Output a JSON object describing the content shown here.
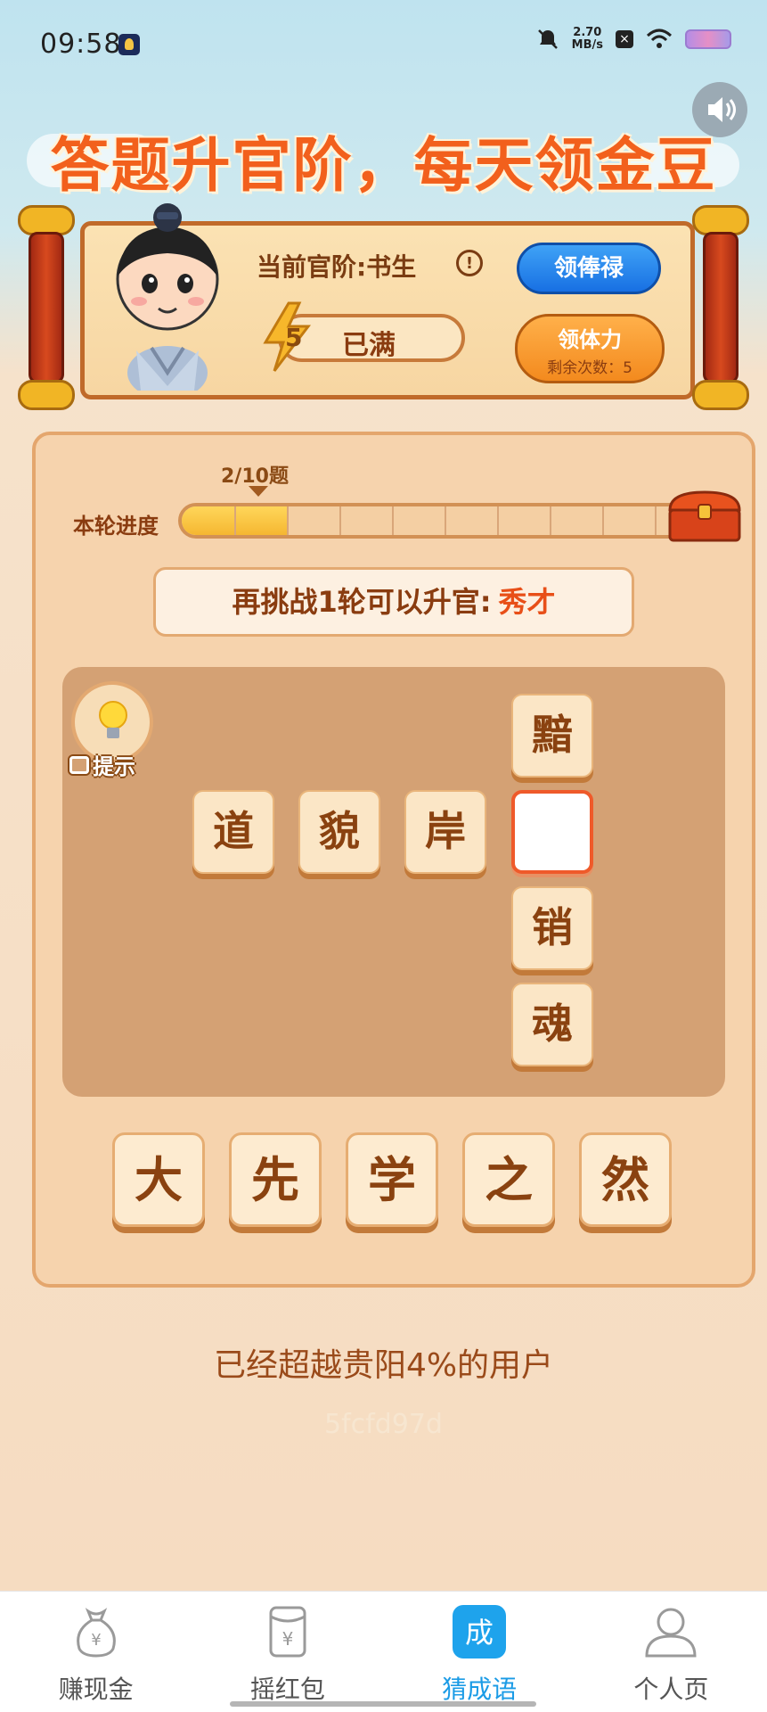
{
  "status_bar": {
    "time": "09:58",
    "network_speed_value": "2.70",
    "network_speed_unit": "MB/s"
  },
  "header": {
    "headline": "答题升官阶，每天领金豆"
  },
  "rank_card": {
    "rank_label": "当前官阶:书生",
    "energy_count": "5",
    "energy_status": "已满",
    "salary_button": "领俸禄",
    "stamina_button": "领体力",
    "stamina_remaining": "剩余次数：5"
  },
  "progress": {
    "marker": "2/10题",
    "label": "本轮进度",
    "current": 2,
    "total": 10
  },
  "challenge": {
    "text": "再挑战1轮可以升官:",
    "next_rank": "秀才"
  },
  "board": {
    "hint_label": "提示",
    "row_tiles": [
      "道",
      "貌",
      "岸"
    ],
    "column_tiles": [
      "黯",
      "",
      "销",
      "魂"
    ]
  },
  "choices": [
    "大",
    "先",
    "学",
    "之",
    "然"
  ],
  "footer": {
    "surpass_text": "已经超越贵阳4%的用户",
    "user_code": "5fcfd97d"
  },
  "nav": {
    "items": [
      {
        "label": "赚现金",
        "icon": "money-bag-icon"
      },
      {
        "label": "摇红包",
        "icon": "red-packet-icon"
      },
      {
        "label": "猜成语",
        "icon": "idiom-icon",
        "icon_text": "成",
        "active": true
      },
      {
        "label": "个人页",
        "icon": "person-icon"
      }
    ]
  },
  "colors": {
    "accent_orange": "#f2601c",
    "active_blue": "#1a9be6"
  }
}
